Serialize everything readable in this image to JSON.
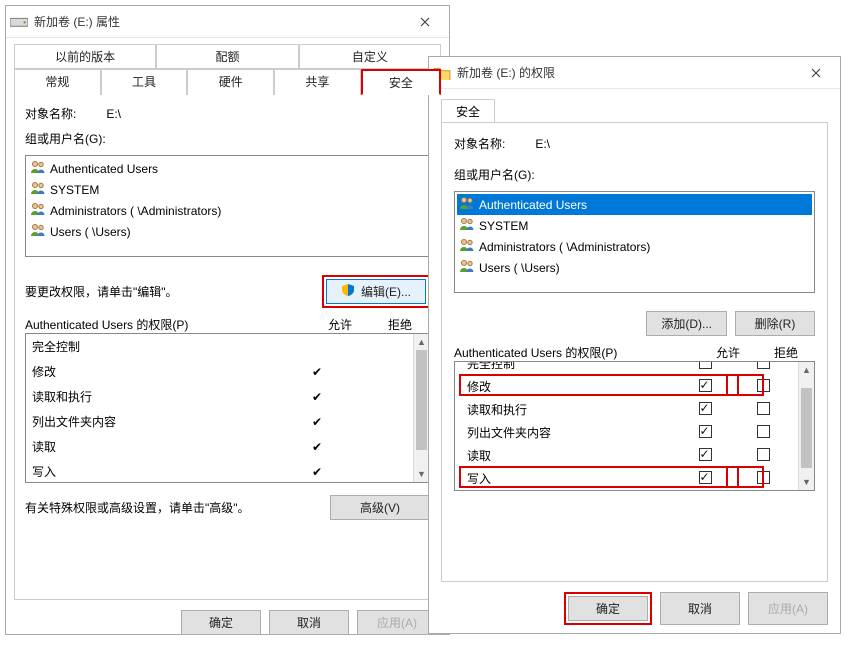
{
  "win1": {
    "title": "新加卷 (E:) 属性",
    "tabs_top": [
      "以前的版本",
      "配额",
      "自定义"
    ],
    "tabs_bottom": [
      "常规",
      "工具",
      "硬件",
      "共享",
      "安全"
    ],
    "selected_tab": "安全",
    "obj_label": "对象名称:",
    "obj_value": "E:\\",
    "groups_label": "组或用户名(G):",
    "group_items": [
      "Authenticated Users",
      "SYSTEM",
      "Administrators (             \\Administrators)",
      "Users (            \\Users)"
    ],
    "edit_hint": "要更改权限，请单击\"编辑\"。",
    "edit_btn": "编辑(E)...",
    "perm_label": "Authenticated Users 的权限(P)",
    "perm_allow": "允许",
    "perm_deny": "拒绝",
    "perm_rows": [
      {
        "name": "完全控制",
        "allow": false,
        "deny": false
      },
      {
        "name": "修改",
        "allow": true,
        "deny": false
      },
      {
        "name": "读取和执行",
        "allow": true,
        "deny": false
      },
      {
        "name": "列出文件夹内容",
        "allow": true,
        "deny": false
      },
      {
        "name": "读取",
        "allow": true,
        "deny": false
      },
      {
        "name": "写入",
        "allow": true,
        "deny": false
      }
    ],
    "adv_hint": "有关特殊权限或高级设置，请单击\"高级\"。",
    "adv_btn": "高级(V)",
    "ok": "确定",
    "cancel": "取消",
    "apply": "应用(A)"
  },
  "win2": {
    "title": "新加卷 (E:) 的权限",
    "tab": "安全",
    "obj_label": "对象名称:",
    "obj_value": "E:\\",
    "groups_label": "组或用户名(G):",
    "group_items": [
      "Authenticated Users",
      "SYSTEM",
      "Administrators (             \\Administrators)",
      "Users (            \\Users)"
    ],
    "add_btn": "添加(D)...",
    "remove_btn": "删除(R)",
    "perm_label": "Authenticated Users 的权限(P)",
    "perm_allow": "允许",
    "perm_deny": "拒绝",
    "perm_rows": [
      {
        "name": "完全控制",
        "allow": false,
        "deny": false
      },
      {
        "name": "修改",
        "allow": true,
        "deny": false
      },
      {
        "name": "读取和执行",
        "allow": true,
        "deny": false
      },
      {
        "name": "列出文件夹内容",
        "allow": true,
        "deny": false
      },
      {
        "name": "读取",
        "allow": true,
        "deny": false
      },
      {
        "name": "写入",
        "allow": true,
        "deny": false
      }
    ],
    "ok": "确定",
    "cancel": "取消",
    "apply": "应用(A)"
  }
}
